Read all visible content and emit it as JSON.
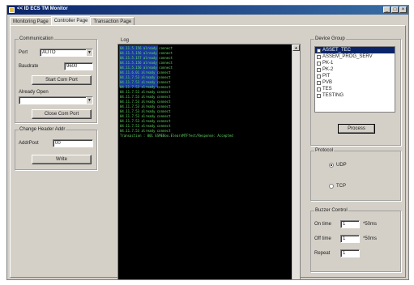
{
  "window": {
    "title": "<< ID ECS TM Monitor",
    "controls": [
      "_",
      "□",
      "×"
    ]
  },
  "tabs": [
    "Monitoring Page",
    "Controller Page",
    "Transaction Page"
  ],
  "communication": {
    "group_label": "Communication",
    "port_label": "Port",
    "port_value": "AUTO",
    "baudrate_label": "Baudrate",
    "baudrate_value": "9600",
    "start_button": "Start Com Port",
    "setting_label": "Already Open",
    "setting_value": "",
    "close_button": "Close Com Port"
  },
  "change_header": {
    "group_label": "Change Header Addr",
    "addr_label": "AddrPost",
    "addr_value": "00",
    "write_button": "Write"
  },
  "log": {
    "label": "Log",
    "lines": [
      "04.11.5.156 already connect",
      "04.11.5.156 already connect",
      "04.11.5.157 already connect",
      "04.11.5.156 already connect",
      "04.11.5.156 already connect",
      "04.11.6.01 already connect",
      "04.11.7.53 already connect",
      "04.11.7.53 already connect",
      "04.11.7.53 already connect",
      "04.11.7.53 already connect",
      "04.11.7.53 already connect",
      "04.11.7.53 already connect",
      "04.11.7.53 already connect",
      "04.11.7.53 already connect",
      "04.11.7.53 already connect",
      "04.11.7.53 already connect",
      "04.11.7.53 already connect",
      "04.11.7.53 already connect",
      "Transaction : 001 ESMEBox.ElearnMTFfest/Response: Accepted"
    ]
  },
  "device_group": {
    "label": "Device Group",
    "items": [
      "ASSET_TEC",
      "ASSEM_PROG_SERV",
      "PK-1",
      "PK-2",
      "PIT",
      "PVB",
      "TES",
      "TESTING"
    ],
    "selected_index": 0,
    "process_button": "Process"
  },
  "protocol": {
    "label": "Protocol",
    "options": [
      "UDP",
      "TCP"
    ],
    "selected": "UDP"
  },
  "buzzer": {
    "label": "Buzzer Control",
    "on_time_label": "On time",
    "on_time_value": "1",
    "on_time_unit": "*50ms",
    "off_time_label": "Off time",
    "off_time_value": "1",
    "off_time_unit": "*50ms",
    "repeat_label": "Repeat",
    "repeat_value": "1"
  }
}
